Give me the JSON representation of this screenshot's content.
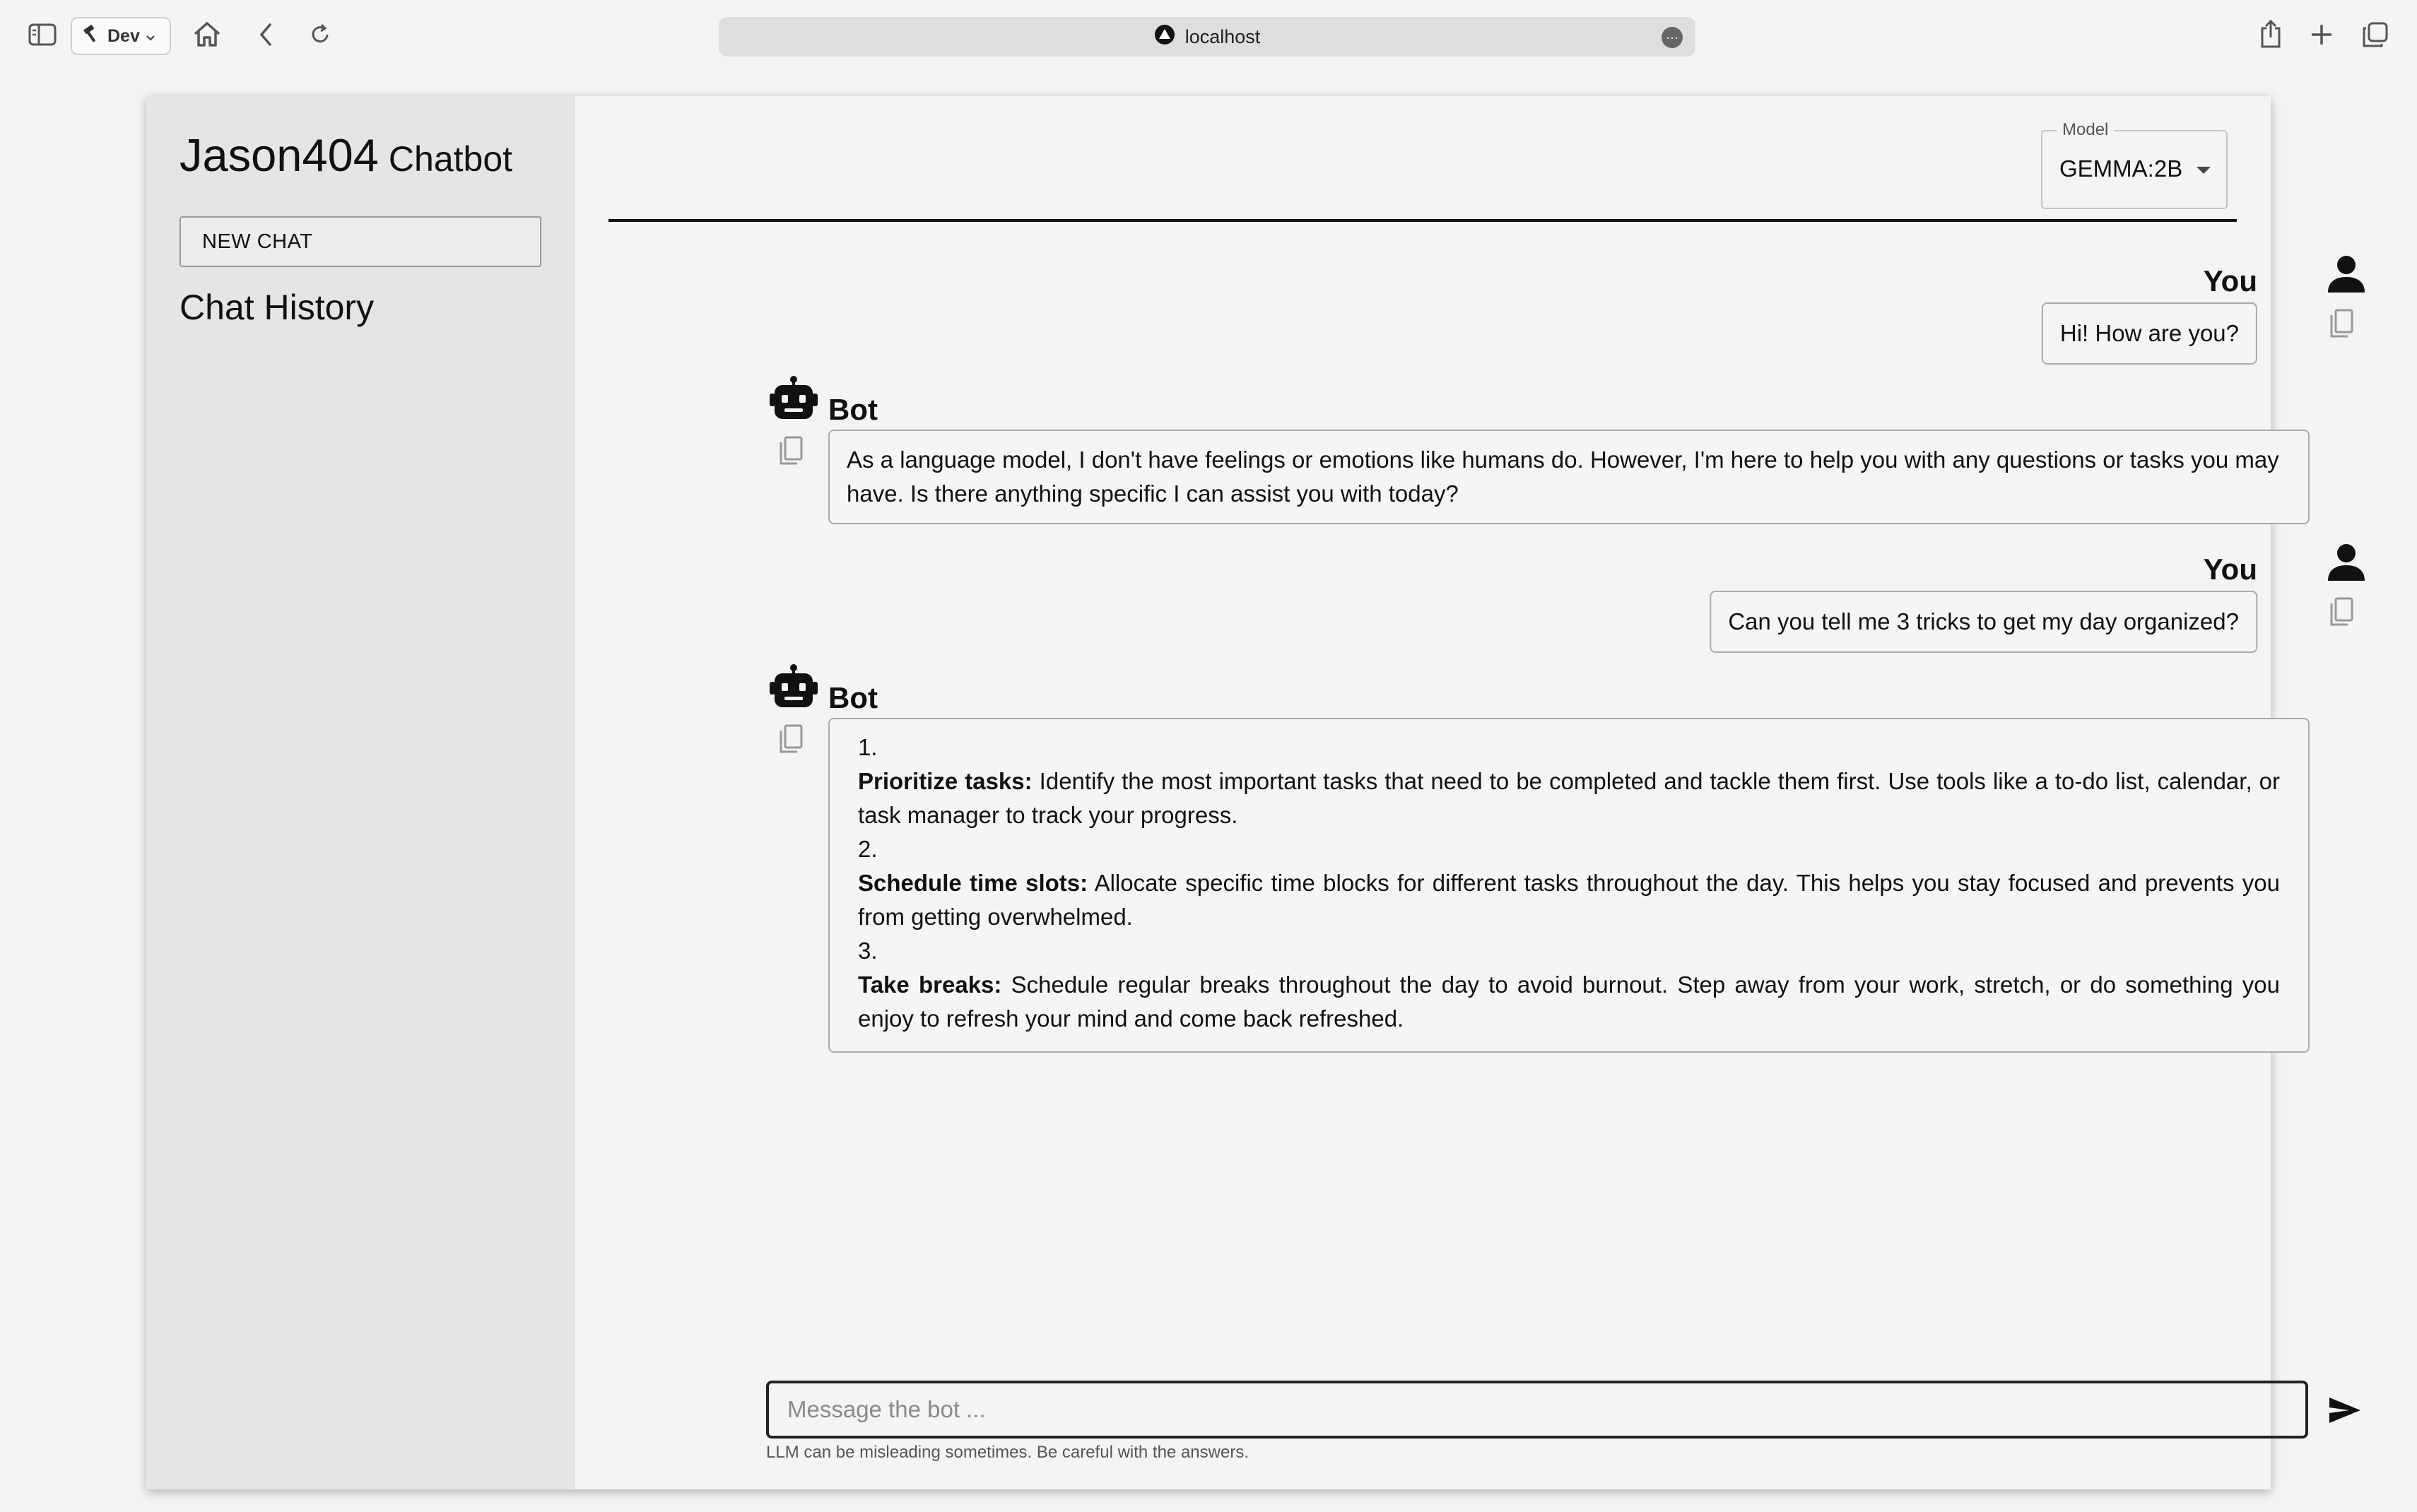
{
  "browser": {
    "dev_label": "Dev",
    "url": "localhost"
  },
  "sidebar": {
    "brand_main": "Jason404",
    "brand_sub": "Chatbot",
    "new_chat_label": "NEW CHAT",
    "history_title": "Chat History"
  },
  "header": {
    "model_label": "Model",
    "model_value": "GEMMA:2B"
  },
  "messages": [
    {
      "role": "user",
      "author": "You",
      "text": "Hi! How are you?"
    },
    {
      "role": "bot",
      "author": "Bot",
      "text": "As a language model, I don't have feelings or emotions like humans do. However, I'm here to help you with any questions or tasks you may have. Is there anything specific I can assist you with today?"
    },
    {
      "role": "user",
      "author": "You",
      "text": "Can you tell me 3 tricks to get my day organized?"
    },
    {
      "role": "bot",
      "author": "Bot",
      "list": [
        {
          "num": "1.",
          "title": "Prioritize tasks:",
          "text": " Identify the most important tasks that need to be completed and tackle them first. Use tools like a to-do list, calendar, or task manager to track your progress."
        },
        {
          "num": "2.",
          "title": "Schedule time slots:",
          "text": " Allocate specific time blocks for different tasks throughout the day. This helps you stay focused and prevents you from getting overwhelmed."
        },
        {
          "num": "3.",
          "title": "Take breaks:",
          "text": " Schedule regular breaks throughout the day to avoid burnout. Step away from your work, stretch, or do something you enjoy to refresh your mind and come back refreshed."
        }
      ]
    }
  ],
  "composer": {
    "placeholder": "Message the bot ...",
    "value": "",
    "disclaimer": "LLM can be misleading sometimes. Be careful with the answers."
  },
  "icons": {
    "sidebar_toggle": "sidebar-icon",
    "hammer": "hammer-icon",
    "home": "home-icon",
    "back": "chevron-left-icon",
    "reload": "reload-icon",
    "share": "share-icon",
    "new_tab": "plus-icon",
    "tabs": "tabs-icon",
    "user": "person-icon",
    "bot": "robot-icon",
    "copy": "copy-icon",
    "send": "send-icon"
  }
}
